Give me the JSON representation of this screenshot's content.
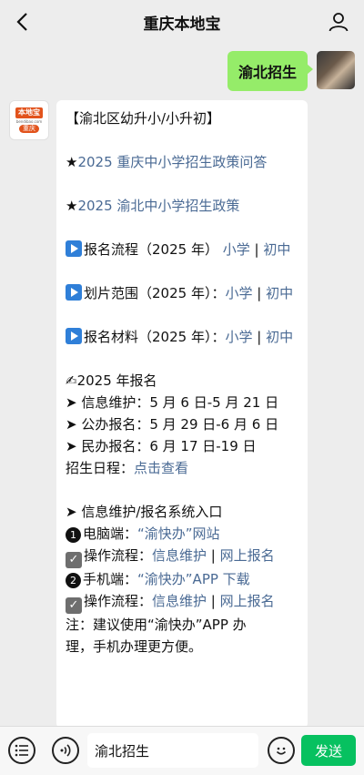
{
  "header": {
    "title": "重庆本地宝"
  },
  "sent": {
    "text": "渝北招生"
  },
  "avatar_logo": {
    "top": "本地宝",
    "url": "bendibao.com",
    "city": "重庆"
  },
  "message": {
    "heading": "【渝北区幼升小/小升初】",
    "policy_qa": "2025 重庆中小学招生政策问答",
    "policy": "2025 渝北中小学招生政策",
    "process": {
      "label": "报名流程（2025 年）",
      "link1": "小学",
      "link2": "初中"
    },
    "zones": {
      "label": "划片范围（2025 年）：",
      "link1": "小学",
      "link2": "初中"
    },
    "materials": {
      "label": "报名材料（2025 年）：",
      "link1": "小学",
      "link2": "初中"
    },
    "reg_title": "2025 年报名",
    "info_maint": "➤ 信息维护：5 月 6 日-5 月 21 日",
    "public_reg": "➤ 公办报名：5 月 29 日-6 月 6 日",
    "private_reg": "➤ 民办报名：6 月 17 日-19 日",
    "schedule_label": "招生日程：",
    "schedule_link": "点击查看",
    "entry_title": "➤ 信息维护/报名系统入口",
    "pc_label": "电脑端：",
    "pc_link": "“渝快办”网站",
    "op_label": "操作流程：",
    "op_link1": "信息维护",
    "op_link2": "网上报名",
    "mobile_label": "手机端：",
    "mobile_link": "“渝快办”APP 下载",
    "op2_label": "操作流程：",
    "op2_link1": "信息维护",
    "op2_link2": "网上报名",
    "note1": "注：建议使用“渝快办”APP 办",
    "note2": "理，手机办理更方便。"
  },
  "input": {
    "value": "渝北招生"
  },
  "send_label": "发送",
  "colors": {
    "send": "#07c160",
    "bubble_sent": "#95ec69",
    "link": "#4a6a94"
  }
}
